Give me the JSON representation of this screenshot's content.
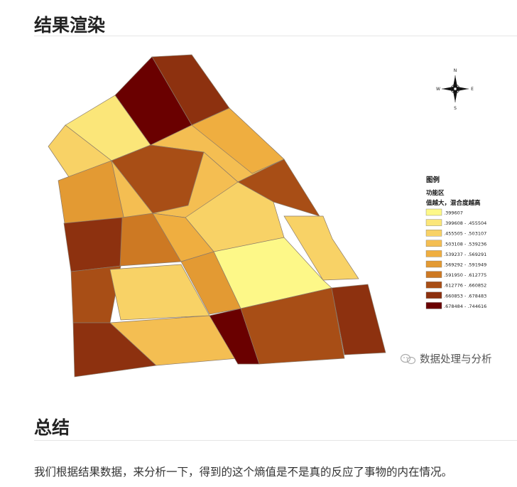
{
  "article": {
    "heading_render": "结果渲染",
    "heading_summary": "总结",
    "paragraph": "我们根据结果数据，来分析一下，得到的这个熵值是不是真的反应了事物的内在情况。"
  },
  "map": {
    "compass": {
      "n": "N",
      "s": "S",
      "e": "E",
      "w": "W"
    },
    "legend": {
      "title": "图例",
      "layer": "功能区",
      "field": "值越大，混合度越高",
      "classes": [
        {
          "label": ".399607",
          "color": "#fdf888"
        },
        {
          "label": ".399608 - .455504",
          "color": "#fbe679"
        },
        {
          "label": ".455505 - .503107",
          "color": "#f8d266"
        },
        {
          "label": ".503108 - .539236",
          "color": "#f4be52"
        },
        {
          "label": ".539237 - .569291",
          "color": "#efae40"
        },
        {
          "label": ".569292 - .591949",
          "color": "#e39a33"
        },
        {
          "label": ".591950 - .612775",
          "color": "#cd7923"
        },
        {
          "label": ".612776 - .660852",
          "color": "#a84e16"
        },
        {
          "label": ".660853 - .678483",
          "color": "#8d310f"
        },
        {
          "label": ".678484 - .744616",
          "color": "#6a0000"
        }
      ]
    },
    "watermark": "数据处理与分析"
  }
}
